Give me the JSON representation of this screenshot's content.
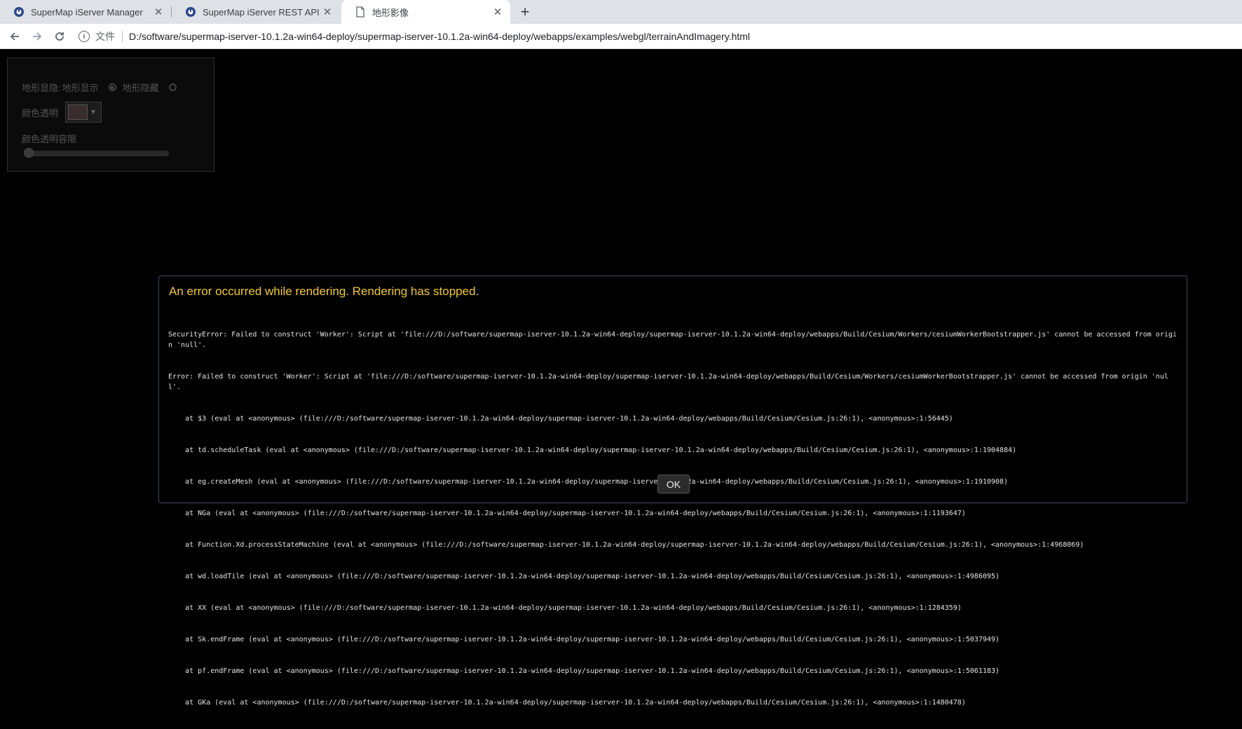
{
  "browser": {
    "tabs": [
      {
        "title": "SuperMap iServer Manager",
        "icon": "supermap-logo-icon"
      },
      {
        "title": "SuperMap iServer REST API",
        "icon": "supermap-logo-icon"
      },
      {
        "title": "地形影像",
        "icon": "document-icon",
        "active": true
      }
    ],
    "new_tab_glyph": "+",
    "close_glyph": "✕",
    "scheme_label": "文件",
    "url": "D:/software/supermap-iserver-10.1.2a-win64-deploy/supermap-iserver-10.1.2a-win64-deploy/webapps/examples/webgl/terrainAndImagery.html"
  },
  "toolpanel": {
    "terrain_label": "地形显隐:",
    "show_label": "地形显示",
    "hide_label": "地形隐藏",
    "color_label": "颜色透明",
    "swatch_color": "#3b2c2f",
    "tolerance_label": "颜色透明容限",
    "tolerance_value": 0
  },
  "error_dialog": {
    "title": "An error occurred while rendering. Rendering has stopped.",
    "lines": [
      "SecurityError: Failed to construct 'Worker': Script at 'file:///D:/software/supermap-iserver-10.1.2a-win64-deploy/supermap-iserver-10.1.2a-win64-deploy/webapps/Build/Cesium/Workers/cesiumWorkerBootstrapper.js' cannot be accessed from origin 'null'.",
      "Error: Failed to construct 'Worker': Script at 'file:///D:/software/supermap-iserver-10.1.2a-win64-deploy/supermap-iserver-10.1.2a-win64-deploy/webapps/Build/Cesium/Workers/cesiumWorkerBootstrapper.js' cannot be accessed from origin 'null'.",
      "    at $3 (eval at <anonymous> (file:///D:/software/supermap-iserver-10.1.2a-win64-deploy/supermap-iserver-10.1.2a-win64-deploy/webapps/Build/Cesium/Cesium.js:26:1), <anonymous>:1:56445)",
      "    at td.scheduleTask (eval at <anonymous> (file:///D:/software/supermap-iserver-10.1.2a-win64-deploy/supermap-iserver-10.1.2a-win64-deploy/webapps/Build/Cesium/Cesium.js:26:1), <anonymous>:1:1904884)",
      "    at eg.createMesh (eval at <anonymous> (file:///D:/software/supermap-iserver-10.1.2a-win64-deploy/supermap-iserver-10.1.2a-win64-deploy/webapps/Build/Cesium/Cesium.js:26:1), <anonymous>:1:1910908)",
      "    at NGa (eval at <anonymous> (file:///D:/software/supermap-iserver-10.1.2a-win64-deploy/supermap-iserver-10.1.2a-win64-deploy/webapps/Build/Cesium/Cesium.js:26:1), <anonymous>:1:1193647)",
      "    at Function.Xd.processStateMachine (eval at <anonymous> (file:///D:/software/supermap-iserver-10.1.2a-win64-deploy/supermap-iserver-10.1.2a-win64-deploy/webapps/Build/Cesium/Cesium.js:26:1), <anonymous>:1:4968069)",
      "    at wd.loadTile (eval at <anonymous> (file:///D:/software/supermap-iserver-10.1.2a-win64-deploy/supermap-iserver-10.1.2a-win64-deploy/webapps/Build/Cesium/Cesium.js:26:1), <anonymous>:1:4986095)",
      "    at XX (eval at <anonymous> (file:///D:/software/supermap-iserver-10.1.2a-win64-deploy/supermap-iserver-10.1.2a-win64-deploy/webapps/Build/Cesium/Cesium.js:26:1), <anonymous>:1:1284359)",
      "    at Sk.endFrame (eval at <anonymous> (file:///D:/software/supermap-iserver-10.1.2a-win64-deploy/supermap-iserver-10.1.2a-win64-deploy/webapps/Build/Cesium/Cesium.js:26:1), <anonymous>:1:5037949)",
      "    at pf.endFrame (eval at <anonymous> (file:///D:/software/supermap-iserver-10.1.2a-win64-deploy/supermap-iserver-10.1.2a-win64-deploy/webapps/Build/Cesium/Cesium.js:26:1), <anonymous>:1:5061183)",
      "    at GKa (eval at <anonymous> (file:///D:/software/supermap-iserver-10.1.2a-win64-deploy/supermap-iserver-10.1.2a-win64-deploy/webapps/Build/Cesium/Cesium.js:26:1), <anonymous>:1:1480478)"
    ],
    "ok_label": "OK",
    "title_color": "#f0c93a"
  }
}
